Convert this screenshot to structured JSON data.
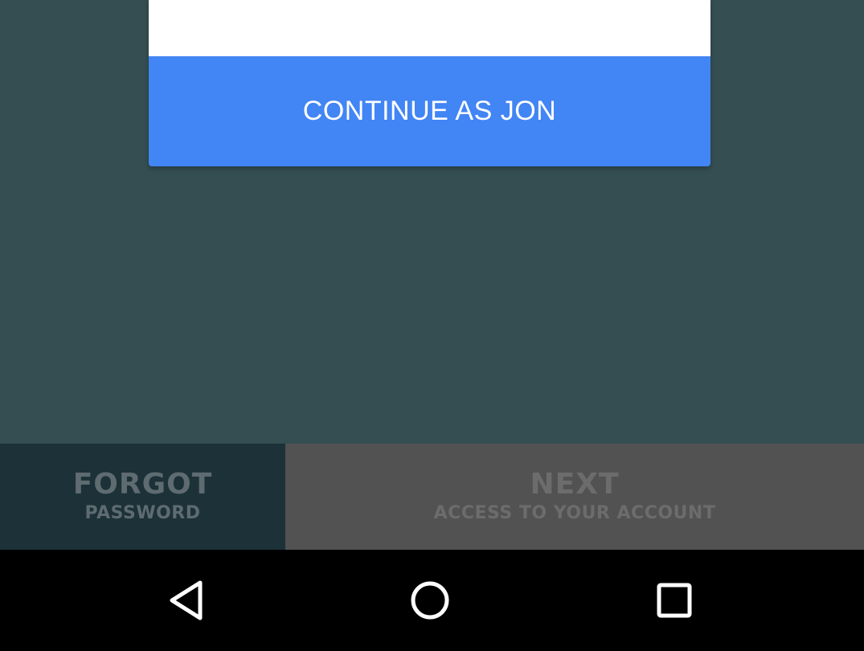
{
  "dialog": {
    "continue_label": "CONTINUE AS JON"
  },
  "bottom_bar": {
    "forgot": {
      "title": "FORGOT",
      "subtitle": "PASSWORD"
    },
    "next": {
      "title": "NEXT",
      "subtitle": "ACCESS TO YOUR ACCOUNT"
    }
  },
  "nav_bar": {
    "icons": [
      "back-icon",
      "home-icon",
      "recents-icon"
    ]
  },
  "colors": {
    "background": "#344e52",
    "accent_button": "#4285f4",
    "forgot_bg": "#1c3138",
    "next_bg": "#525252",
    "nav_bar": "#000000"
  }
}
